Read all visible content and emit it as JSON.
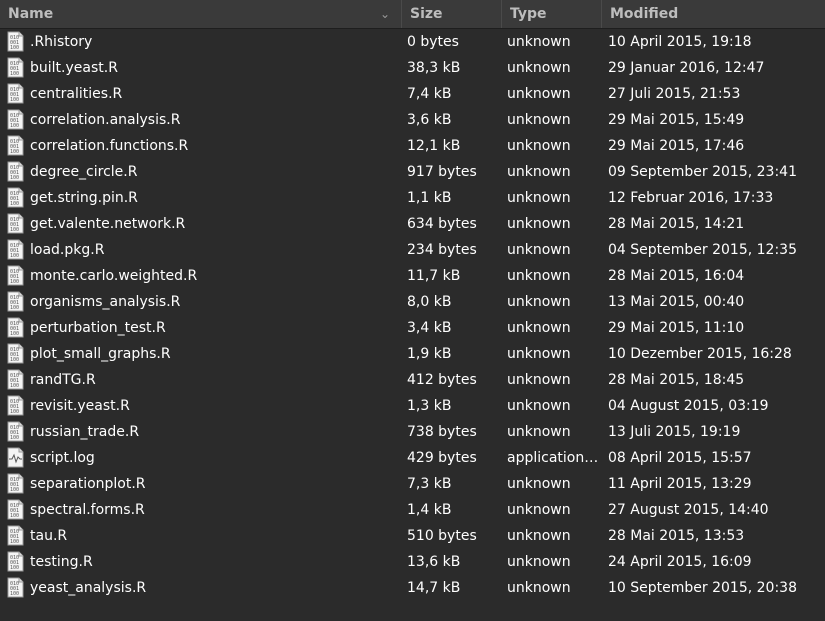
{
  "columns": {
    "name": "Name",
    "size": "Size",
    "type": "Type",
    "modified": "Modified",
    "sort_icon": "chevron-down-icon"
  },
  "colors": {
    "background": "#2b2b2b",
    "header_bg": "#3a3a3a",
    "header_text": "#bdbdbd",
    "text": "#ffffff"
  },
  "files": [
    {
      "name": ".Rhistory",
      "size": "0 bytes",
      "type": "unknown",
      "modified": "10 April 2015, 19:18",
      "icon": "binary-file-icon"
    },
    {
      "name": "built.yeast.R",
      "size": "38,3 kB",
      "type": "unknown",
      "modified": "29 Januar 2016, 12:47",
      "icon": "binary-file-icon"
    },
    {
      "name": "centralities.R",
      "size": "7,4 kB",
      "type": "unknown",
      "modified": "27 Juli 2015, 21:53",
      "icon": "binary-file-icon"
    },
    {
      "name": "correlation.analysis.R",
      "size": "3,6 kB",
      "type": "unknown",
      "modified": "29 Mai 2015, 15:49",
      "icon": "binary-file-icon"
    },
    {
      "name": "correlation.functions.R",
      "size": "12,1 kB",
      "type": "unknown",
      "modified": "29 Mai 2015, 17:46",
      "icon": "binary-file-icon"
    },
    {
      "name": "degree_circle.R",
      "size": "917 bytes",
      "type": "unknown",
      "modified": "09 September 2015, 23:41",
      "icon": "binary-file-icon"
    },
    {
      "name": "get.string.pin.R",
      "size": "1,1 kB",
      "type": "unknown",
      "modified": "12 Februar 2016, 17:33",
      "icon": "binary-file-icon"
    },
    {
      "name": "get.valente.network.R",
      "size": "634 bytes",
      "type": "unknown",
      "modified": "28 Mai 2015, 14:21",
      "icon": "binary-file-icon"
    },
    {
      "name": "load.pkg.R",
      "size": "234 bytes",
      "type": "unknown",
      "modified": "04 September 2015, 12:35",
      "icon": "binary-file-icon"
    },
    {
      "name": "monte.carlo.weighted.R",
      "size": "11,7 kB",
      "type": "unknown",
      "modified": "28 Mai 2015, 16:04",
      "icon": "binary-file-icon"
    },
    {
      "name": "organisms_analysis.R",
      "size": "8,0 kB",
      "type": "unknown",
      "modified": "13 Mai 2015, 00:40",
      "icon": "binary-file-icon"
    },
    {
      "name": "perturbation_test.R",
      "size": "3,4 kB",
      "type": "unknown",
      "modified": "29 Mai 2015, 11:10",
      "icon": "binary-file-icon"
    },
    {
      "name": "plot_small_graphs.R",
      "size": "1,9 kB",
      "type": "unknown",
      "modified": "10 Dezember 2015, 16:28",
      "icon": "binary-file-icon"
    },
    {
      "name": "randTG.R",
      "size": "412 bytes",
      "type": "unknown",
      "modified": "28 Mai 2015, 18:45",
      "icon": "binary-file-icon"
    },
    {
      "name": "revisit.yeast.R",
      "size": "1,3 kB",
      "type": "unknown",
      "modified": "04 August 2015, 03:19",
      "icon": "binary-file-icon"
    },
    {
      "name": "russian_trade.R",
      "size": "738 bytes",
      "type": "unknown",
      "modified": "13 Juli 2015, 19:19",
      "icon": "binary-file-icon"
    },
    {
      "name": "script.log",
      "size": "429 bytes",
      "type": "application…",
      "modified": "08 April 2015, 15:57",
      "icon": "log-file-icon"
    },
    {
      "name": "separationplot.R",
      "size": "7,3 kB",
      "type": "unknown",
      "modified": "11 April 2015, 13:29",
      "icon": "binary-file-icon"
    },
    {
      "name": "spectral.forms.R",
      "size": "1,4 kB",
      "type": "unknown",
      "modified": "27 August 2015, 14:40",
      "icon": "binary-file-icon"
    },
    {
      "name": "tau.R",
      "size": "510 bytes",
      "type": "unknown",
      "modified": "28 Mai 2015, 13:53",
      "icon": "binary-file-icon"
    },
    {
      "name": "testing.R",
      "size": "13,6 kB",
      "type": "unknown",
      "modified": "24 April 2015, 16:09",
      "icon": "binary-file-icon"
    },
    {
      "name": "yeast_analysis.R",
      "size": "14,7 kB",
      "type": "unknown",
      "modified": "10 September 2015, 20:38",
      "icon": "binary-file-icon"
    }
  ]
}
